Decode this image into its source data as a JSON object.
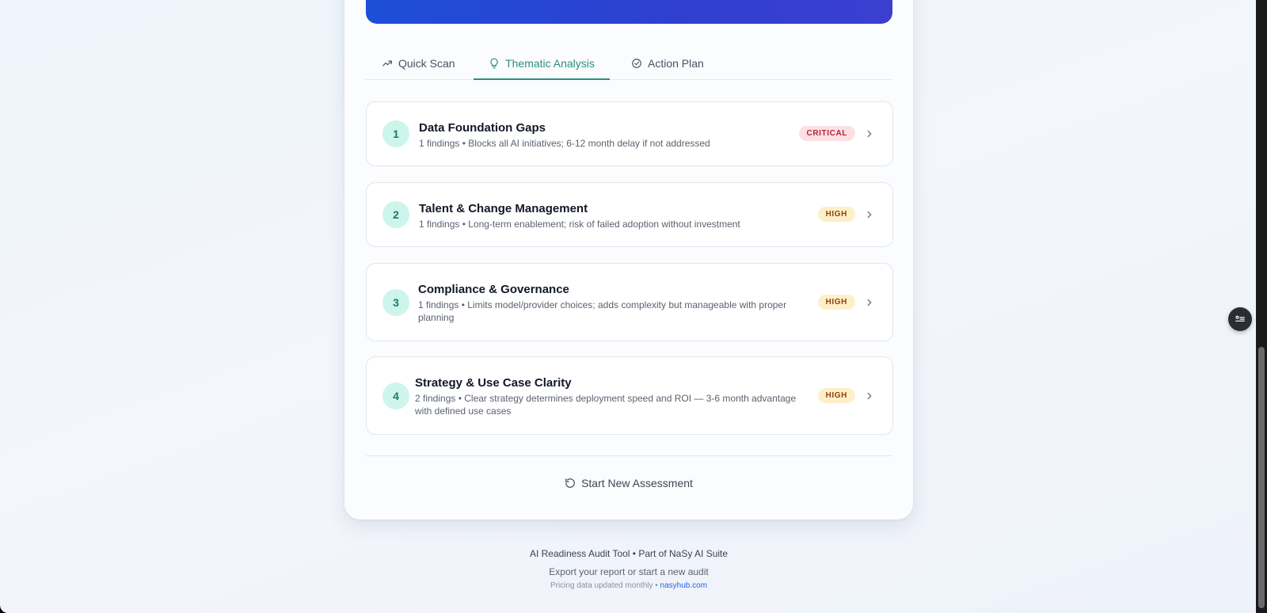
{
  "tabs": [
    {
      "label": "Quick Scan",
      "icon": "trending-up-icon"
    },
    {
      "label": "Thematic Analysis",
      "icon": "lightbulb-icon",
      "active": true
    },
    {
      "label": "Action Plan",
      "icon": "check-circle-icon"
    }
  ],
  "themes": [
    {
      "number": "1",
      "title": "Data Foundation Gaps",
      "description": "1 findings • Blocks all AI initiatives; 6-12 month delay if not addressed",
      "severity": "CRITICAL"
    },
    {
      "number": "2",
      "title": "Talent & Change Management",
      "description": "1 findings • Long-term enablement; risk of failed adoption without investment",
      "severity": "HIGH"
    },
    {
      "number": "3",
      "title": "Compliance & Governance",
      "description": "1 findings • Limits model/provider choices; adds complexity but manageable with proper planning",
      "severity": "HIGH"
    },
    {
      "number": "4",
      "title": "Strategy & Use Case Clarity",
      "description": "2 findings • Clear strategy determines deployment speed and ROI — 3-6 month advantage with defined use cases",
      "severity": "HIGH"
    }
  ],
  "restart_label": "Start New Assessment",
  "footer": {
    "line1": "AI Readiness Audit Tool • Part of NaSy AI Suite",
    "line2": "Export your report or start a new audit",
    "line3_prefix": "Pricing data updated monthly •",
    "link": "nasyhub.com"
  },
  "colors": {
    "accent": "#2d8f7e",
    "banner": "#1d4ed8",
    "critical": "#b4233a",
    "high": "#92400e"
  }
}
